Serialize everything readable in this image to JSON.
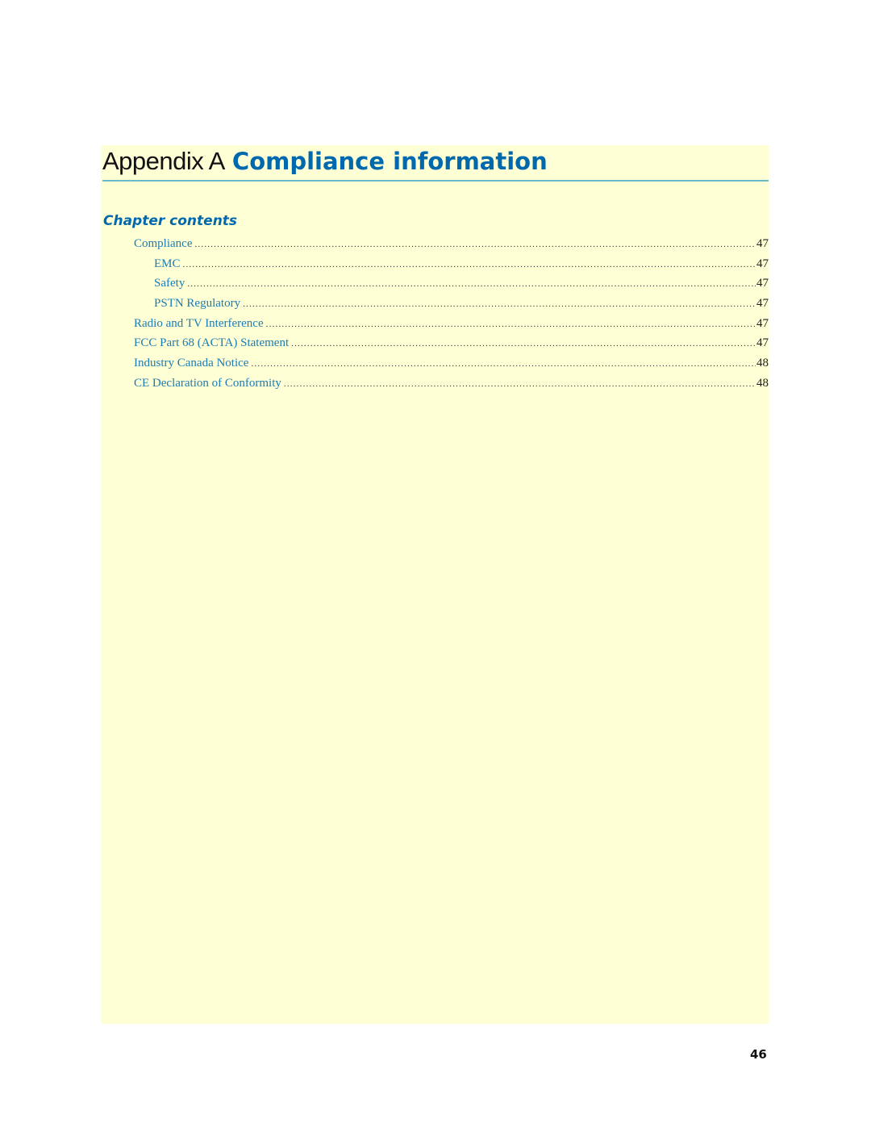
{
  "header": {
    "title_prefix": "Appendix A",
    "title_main": "Compliance information"
  },
  "chapter_contents": {
    "heading": "Chapter contents",
    "entries": [
      {
        "label": "Compliance",
        "page": "47",
        "level": 1
      },
      {
        "label": "EMC",
        "page": "47",
        "level": 2
      },
      {
        "label": "Safety",
        "page": "47",
        "level": 2
      },
      {
        "label": "PSTN Regulatory",
        "page": "47",
        "level": 2
      },
      {
        "label": "Radio and TV Interference",
        "page": "47",
        "level": 1
      },
      {
        "label": "FCC Part 68 (ACTA) Statement",
        "page": "47",
        "level": 1
      },
      {
        "label": "Industry Canada Notice",
        "page": "48",
        "level": 1
      },
      {
        "label": "CE Declaration of Conformity",
        "page": "48",
        "level": 1
      }
    ]
  },
  "footer": {
    "page_number": "46"
  },
  "colors": {
    "accent": "#0069ad",
    "link": "#1c7bb3",
    "rule": "#6bbcc6",
    "page_background": "#ffffd6"
  }
}
